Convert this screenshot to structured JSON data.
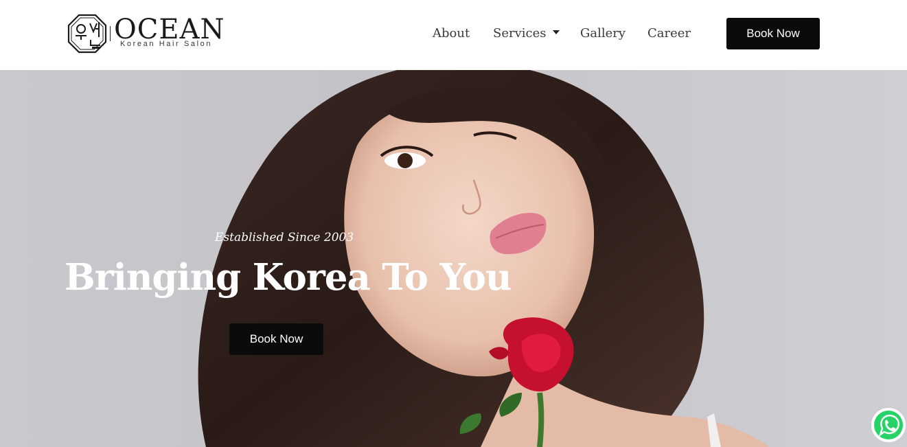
{
  "brand": {
    "name": "OCEAN",
    "tagline": "Korean Hair Salon",
    "emblem_icon": "ocean-hangul-emblem-icon"
  },
  "nav": {
    "items": [
      {
        "label": "About"
      },
      {
        "label": "Services",
        "has_dropdown": true,
        "dropdown_icon": "caret-down-icon"
      },
      {
        "label": "Gallery"
      },
      {
        "label": "Career"
      }
    ],
    "cta_label": "Book Now"
  },
  "hero": {
    "subtitle": "Established Since 2003",
    "title": "Bringing Korea To You",
    "cta_label": "Book Now",
    "background_image": "woman-with-red-rose-photo"
  },
  "floating": {
    "whatsapp_icon": "whatsapp-icon",
    "whatsapp_color": "#25d366"
  },
  "colors": {
    "header_bg": "#ffffff",
    "button_bg": "#0b0b0b",
    "button_text": "#ffffff",
    "nav_text": "#3a3a3a",
    "hero_bg": "#c8c7cc",
    "hero_text": "#ffffff"
  }
}
